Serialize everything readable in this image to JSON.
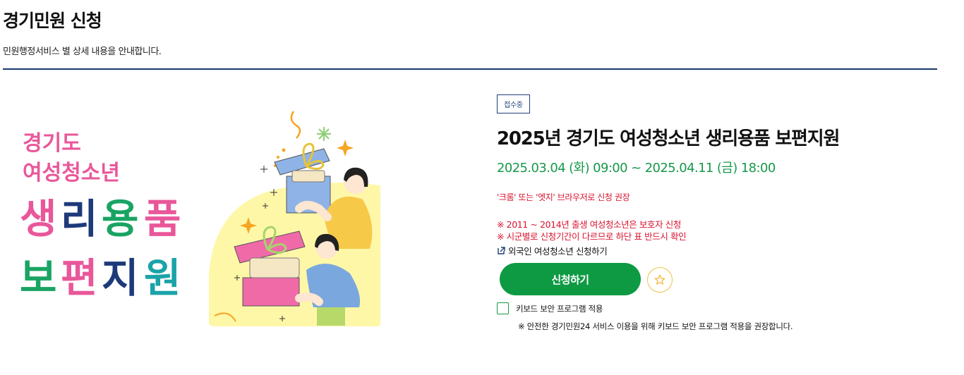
{
  "header": {
    "title": "경기민원 신청",
    "subtitle": "민원행정서비스 별 상세 내용을 안내합니다."
  },
  "hero": {
    "lines": [
      "경기도",
      "여성청소년",
      "생리용품",
      "보편지원"
    ],
    "chars_line3": [
      "생",
      "리",
      "용",
      "품"
    ],
    "chars_line4": [
      "보",
      "편",
      "지",
      "원"
    ],
    "colors": {
      "pink": "#e9579a",
      "navy": "#1d3a7a",
      "green": "#19a463",
      "teal": "#1aa3a8",
      "yellow_bg": "#fff7a8"
    }
  },
  "service": {
    "status_badge": "접수중",
    "title": "2025년 경기도 여성청소년 생리용품 보편지원",
    "period": "2025.03.04 (화) 09:00 ~ 2025.04.11 (금) 18:00",
    "browser_notice": "'크롬' 또는 '엣지' 브라우저로 신청 권장",
    "notes": [
      "※ 2011 ~ 2014년 출생 여성청소년은 보호자 신청",
      "※ 시군별로 신청기간이 다르므로 하단 표 반드시 확인"
    ],
    "foreign_link": "외국인 여성청소년 신청하기",
    "apply_button": "신청하기",
    "keyboard_security_label": "키보드 보안 프로그램 적용",
    "keyboard_security_note": "※ 안전한 경기민원24 서비스 이용을 위해 키보드 보안 프로그램 적용을 권장합니다.",
    "colors": {
      "accent_green": "#0d9a43",
      "notice_red": "#d9132f",
      "badge_navy": "#1d3f78",
      "divider_navy": "#173a6b"
    },
    "icons": [
      "external-link-icon",
      "star-icon"
    ]
  }
}
